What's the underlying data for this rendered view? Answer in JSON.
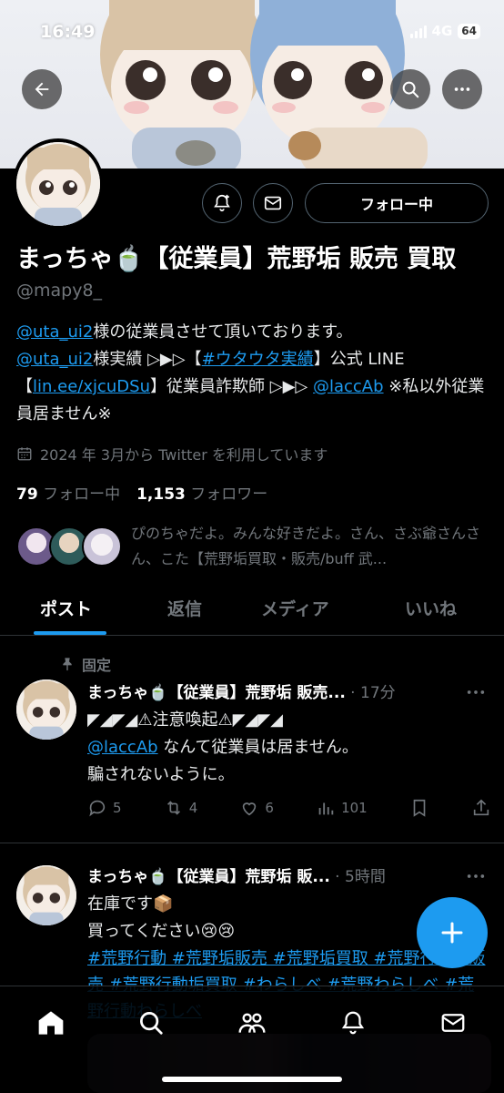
{
  "status_bar": {
    "time": "16:49",
    "network": "4G",
    "battery": "64"
  },
  "profile": {
    "display_name": "まっちゃ🍵【従業員】荒野垢 販売 買取",
    "handle": "@mapy8_",
    "follow_button": "フォロー中",
    "bio": {
      "mention1": "@uta_ui2",
      "text1": "様の従業員させて頂いております。",
      "mention2": "@uta_ui2",
      "text2": "様実績 ▷▶▷【",
      "hashtag": "#ウタウタ実績",
      "text3": "】公式 LINE",
      "text4": "【",
      "link": "lin.ee/xjcuDSu",
      "text5": "】従業員詐欺師 ▷▶▷ ",
      "mention3": "@lacсAb",
      "text6": " ※私以外従業員居ません※"
    },
    "joined": "2024 年 3月から Twitter を利用しています",
    "following_count": "79",
    "following_label": "フォロー中",
    "followers_count": "1,153",
    "followers_label": "フォロワー",
    "followed_by_text": "ぴのちゃだよ。みんな好きだよ。さん、さぶ爺さんさん、こた【荒野垢買取・販売/buff 武..."
  },
  "tabs": [
    "ポスト",
    "返信",
    "メディア",
    "いいね"
  ],
  "posts": [
    {
      "pinned_label": "固定",
      "author": "まっちゃ🍵【従業員】荒野垢 販売...",
      "time": "17分",
      "line1": "◤◢◤◢⚠注意喚起⚠◤◢◤◢",
      "mention": "@lacсAb",
      "line2": " なんて従業員は居ません。",
      "line3": "騙されないように。",
      "replies": "5",
      "retweets": "4",
      "likes": "6",
      "views": "101"
    },
    {
      "author": "まっちゃ🍵【従業員】荒野垢 販...",
      "time": "5時間",
      "line1": "在庫です📦",
      "line2": "買ってください😢😢",
      "hashtags": "#荒野行動 #荒野垢販売 #荒野垢買取 #荒野行動垢販売 #荒野行動垢買取 #わらしべ #荒野わらしべ #荒野行動わらしべ"
    }
  ],
  "colors": {
    "accent": "#1d9bf0",
    "background": "#000000",
    "muted": "#71767b",
    "border": "#2f3336"
  },
  "icons": [
    "back-arrow-icon",
    "search-icon",
    "more-icon",
    "bell-plus-icon",
    "mail-icon",
    "calendar-icon",
    "pin-icon",
    "reply-icon",
    "retweet-icon",
    "like-icon",
    "views-icon",
    "bookmark-icon",
    "share-icon",
    "plus-icon",
    "home-icon",
    "people-icon"
  ]
}
